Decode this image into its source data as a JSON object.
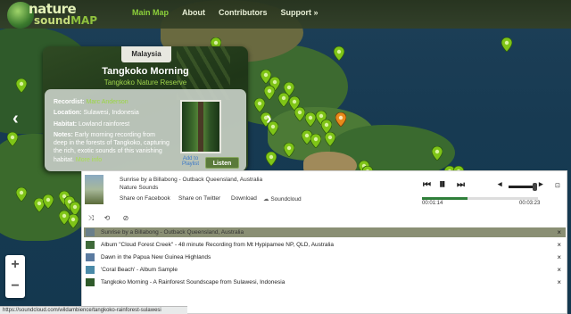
{
  "header": {
    "logo_top": "nature",
    "logo_bottom_a": "sound",
    "logo_bottom_b": "MAP",
    "nav": [
      "Main Map",
      "About",
      "Contributors",
      "Support »"
    ]
  },
  "popup": {
    "country": "Malaysia",
    "title": "Tangkoko Morning",
    "subtitle": "Tangkoko Nature Reserve",
    "recordist_label": "Recordist:",
    "recordist": "Marc Anderson",
    "location_label": "Location:",
    "location": "Sulawesi, Indonesia",
    "habitat_label": "Habitat:",
    "habitat": "Lowland rainforest",
    "notes_label": "Notes:",
    "notes": "Early morning recording from deep in the forests of Tangkoko, capturing the rich, exotic sounds of this vanishing habitat.",
    "more": "More info",
    "add_to": "Add to",
    "playlist": "Playlist",
    "listen": "Listen",
    "prev_arrow": "‹",
    "next_arrow": "›"
  },
  "player": {
    "track_title": "Sunrise by a Billabong - Outback Queensland, Australia",
    "artist": "Nature Sounds",
    "share_facebook": "Share on Facebook",
    "share_twitter": "Share on Twitter",
    "download": "Download",
    "soundcloud": "Soundcloud",
    "time_elapsed": "00:01:14",
    "time_total": "00:03:23",
    "progress": 0.39,
    "volume": 0.9,
    "playlist": [
      {
        "title": "Sunrise by a Billabong - Outback Queensland, Australia",
        "current": true
      },
      {
        "title": "Album \"Cloud Forest Creek\" - 48 minute Recording from Mt Hypipamee NP, QLD, Australia",
        "current": false
      },
      {
        "title": "Dawn in the Papua New Guinea Highlands",
        "current": false
      },
      {
        "title": "'Coral Beach' - Album Sample",
        "current": false
      },
      {
        "title": "Tangkoko Morning - A Rainforest Soundscape from Sulawesi, Indonesia",
        "current": false
      }
    ]
  },
  "zoom": {
    "in": "+",
    "out": "−"
  },
  "status_url": "https://soundcloud.com/wildambience/tangkoko-rainforest-sulawesi",
  "colors": {
    "accent": "#8ccf3a",
    "pin": "#7fc417",
    "pin_selected": "#e88a1a"
  }
}
